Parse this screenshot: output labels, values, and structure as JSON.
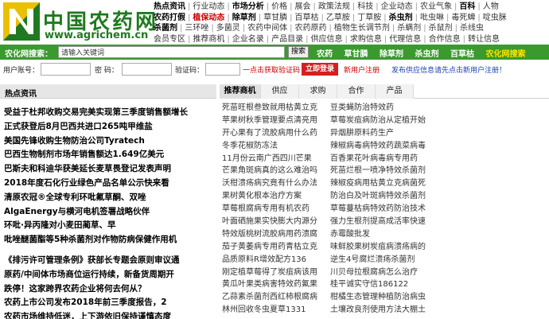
{
  "logo": {
    "mark_letter": "N",
    "name": "中国农药网",
    "url": "www.agrichem.cn",
    "colors": {
      "green": "#1f7a1f",
      "yellow": "#f5c400"
    }
  },
  "topnav": {
    "rows": [
      [
        {
          "t": "热点资讯",
          "s": "b"
        },
        {
          "t": "行业动态",
          "s": "n"
        },
        {
          "t": "市场分析",
          "s": "b"
        },
        {
          "t": "价格",
          "s": "n"
        },
        {
          "t": "展会",
          "s": "n"
        },
        {
          "t": "政策法规",
          "s": "n"
        },
        {
          "t": "科技",
          "s": "n"
        },
        {
          "t": "企业动态",
          "s": "n"
        },
        {
          "t": "农业气象",
          "s": "n"
        },
        {
          "t": "百科",
          "s": "b"
        },
        {
          "t": "人物",
          "s": "n"
        }
      ],
      [
        {
          "t": "农药打假",
          "s": "b"
        },
        {
          "t": "植保动态",
          "s": "r"
        },
        {
          "t": "除草剂",
          "s": "b"
        },
        {
          "t": "草甘膦",
          "s": "n"
        },
        {
          "t": "百草枯",
          "s": "n"
        },
        {
          "t": "乙草胺",
          "s": "n"
        },
        {
          "t": "丁草胺",
          "s": "n"
        },
        {
          "t": "杀虫剂",
          "s": "b"
        },
        {
          "t": "吡虫啉",
          "s": "n"
        },
        {
          "t": "毒死蜱",
          "s": "n"
        },
        {
          "t": "啶虫脒",
          "s": "n"
        }
      ],
      [
        {
          "t": "杀菌剂",
          "s": "b"
        },
        {
          "t": "三环唑",
          "s": "n"
        },
        {
          "t": "多菌灵",
          "s": "n"
        },
        {
          "t": "农药中间体",
          "s": "n"
        },
        {
          "t": "农药原药",
          "s": "n"
        },
        {
          "t": "植物生长调节剂",
          "s": "n"
        },
        {
          "t": "杀螨剂",
          "s": "n"
        },
        {
          "t": "杀鼠剂",
          "s": "n"
        },
        {
          "t": "杀线虫",
          "s": "n"
        }
      ],
      [
        {
          "t": "会员专区",
          "s": "n"
        },
        {
          "t": "推荐商机",
          "s": "n"
        },
        {
          "t": "企业名录",
          "s": "n"
        },
        {
          "t": "产品目录",
          "s": "n"
        },
        {
          "t": "供应信息",
          "s": "n"
        },
        {
          "t": "求购信息",
          "s": "n"
        },
        {
          "t": "代理信息",
          "s": "n"
        },
        {
          "t": "合作信息",
          "s": "n"
        },
        {
          "t": "转让信息",
          "s": "n"
        }
      ]
    ]
  },
  "search": {
    "label": "农化网搜索：",
    "value": "请输入关键词",
    "button": "搜索",
    "links": [
      "农药",
      "草甘膦",
      "除草剂",
      "杀虫剂",
      "百草枯"
    ],
    "special_link": "农化网搜索"
  },
  "login": {
    "user_label": "用户账号：",
    "password_label": "密  码：",
    "captcha_label": "验证码：",
    "captcha_hint": "一点击获取验证码",
    "login_button": "立即登录",
    "register_link": "新用户注册",
    "publish_link": "发布供应信息请先点击新用户注册！"
  },
  "news": {
    "tab": "热点资讯",
    "group1": [
      "受益于杜邦收购交易完美实现第三季度销售额增长",
      "正式获登后8月巴西共进口265吨甲维盐",
      "美国先锋收购生物防治公司Tyratech",
      "巴西生物制剂市场年销售额达1.649亿美元",
      "巴斯夫和科迪华获美延长麦草畏登记发表声明",
      "2018年度石化行业绿色产品名单公示快来看",
      "清原农冠®全球专利环吡氟草酮、双唑",
      "AlgaEnergy与横河电机签署战略伙伴",
      "环吡·异丙隆对小麦田蔺草、早",
      "吡唑醚菌酯等5种杀菌剂对作物防病保健作用机"
    ],
    "group2": [
      "《排污许可管理条例》获部长专题会原则审议通",
      "原药/中间体市场商位运行持续，新备货周期开",
      "跌停！这家跨界农药企业将何去何从？",
      "农药上市公司发布2018年前三季度报告，2",
      "农药市场维持低迷，上下游依旧保持谨慎态度"
    ]
  },
  "market": {
    "tabs": [
      "推荐商机",
      "供应",
      "求购",
      "合作",
      "产品"
    ],
    "columns": [
      [
        "死苗旺根叁致就用枯黄立克",
        "苹果树秋季管理要点清亮用",
        "开心果有了流胶病用什么药",
        "冬季花椒防冻法",
        "11月份云南广西四川芒果",
        "芒果角斑病真的这么难治吗",
        "沃柑溃疡病究竟有什么办法",
        "果树黄化根本治疗方案",
        "草莓根腐病专用有机农药",
        "叶面硒施果实快膨大内源分",
        "特效版桃树流胶病用药溃腐",
        "茄子黄萎病专用药青枯立克",
        "品质原料R增效配方136",
        "刚定植草莓得了炭疽病该用",
        "黄瓜叶果类病害特效药氟果",
        "乙蒜素杀菌剂西红柿根腐病",
        "林州回收冬虫夏草1331"
      ],
      [
        "豆类蝇防治特效药",
        "草莓炭疽病防治从定植开始",
        "异烟肼原料药生产",
        "辣椒病毒病特效药蔬菜病毒",
        "百香果花叶病毒病专用药",
        "死苗烂根一喷净特效杀菌剂",
        "辣椒疫病用枯黄立克病菌死",
        "防治白及叶斑病特效杀菌剂",
        "草莓蔓枯病特效药防治技术",
        "强力生根剂提高成活率快速",
        "赤霉酸批发",
        "味鲜胶果树炭疽病溃疡病的",
        "逆生4号腐烂溃疡杀菌剂",
        "川贝母拉根腐病怎么治疗",
        "桂平诚实守信186122",
        "柑橘生态管理种植防治病虫",
        "土壤改良剂使用方法大棚土"
      ]
    ]
  }
}
